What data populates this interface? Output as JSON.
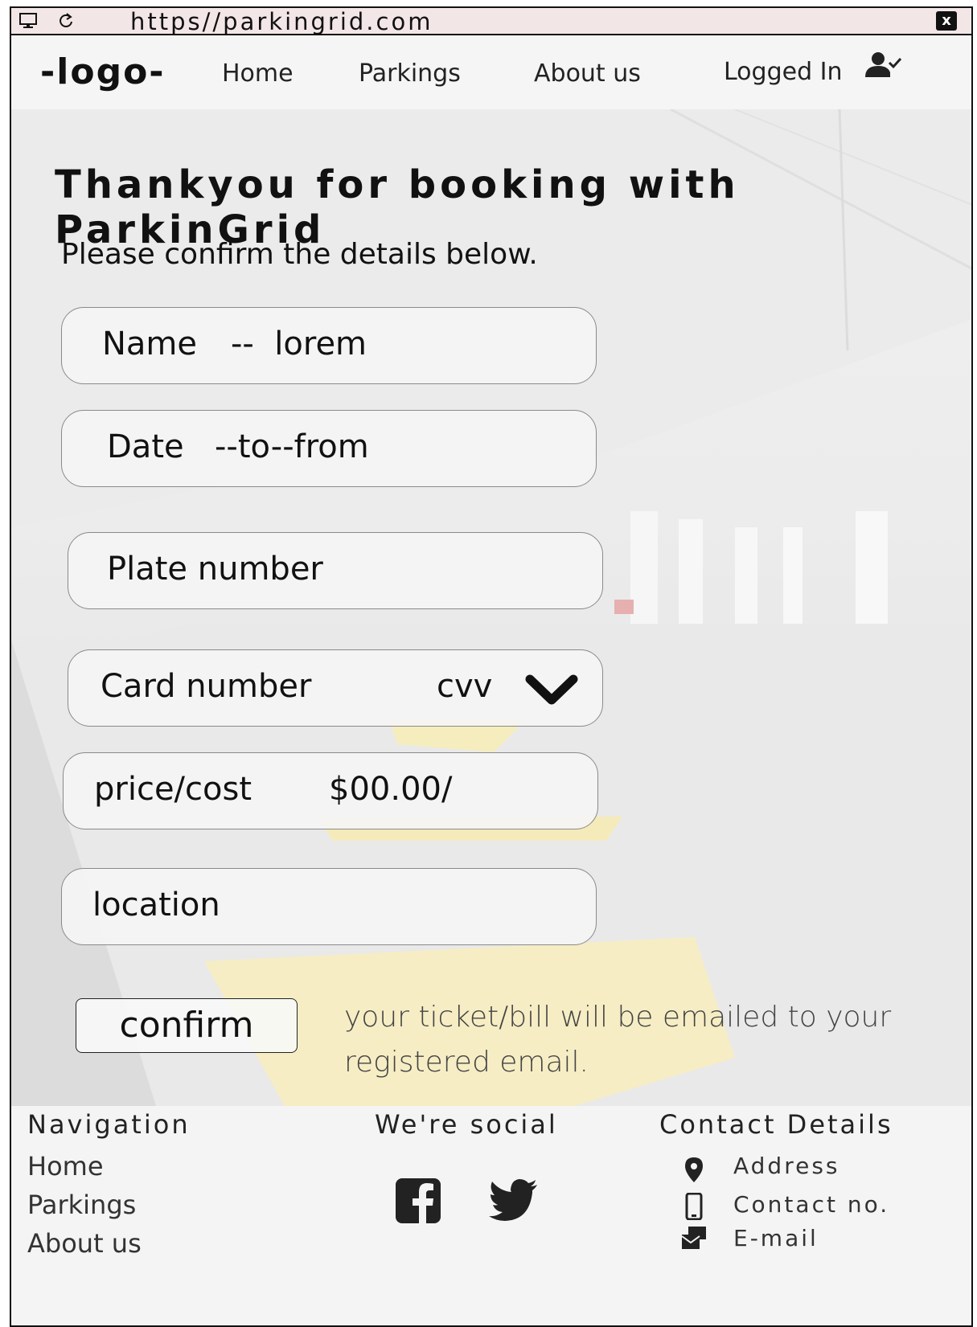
{
  "browser": {
    "url": "https//parkingrid.com",
    "close_label": "x"
  },
  "nav": {
    "logo": "-logo-",
    "home": "Home",
    "parkings": "Parkings",
    "about": "About us",
    "status": "Logged In"
  },
  "main": {
    "title": "Thankyou for booking with ParkinGrid",
    "subtitle": "Please confirm the details below.",
    "name_label": "Name",
    "name_value": "--  lorem",
    "date_label": "Date",
    "date_value": "--to--from",
    "plate_label": "Plate number",
    "card_label": "Card number",
    "cvv_label": "cvv",
    "price_label": "price/cost",
    "price_value": "$00.00/",
    "location_label": "location",
    "confirm_label": "confirm",
    "email_note": "your ticket/bill will be emailed to your registered email."
  },
  "footer": {
    "navigation_title": "Navigation",
    "nav_links": [
      "Home",
      "Parkings",
      "About us"
    ],
    "social_title": "We're social",
    "contact_title": "Contact Details",
    "contact_items": [
      "Address",
      "Contact no.",
      "E-mail"
    ]
  },
  "icons": {
    "monitor": "monitor-icon",
    "reload": "reload-icon",
    "close": "close-icon",
    "user": "user-check-icon",
    "chevron": "chevron-down-icon",
    "facebook": "facebook-icon",
    "twitter": "twitter-icon",
    "pin": "map-pin-icon",
    "phone": "phone-icon",
    "mail": "email-icon"
  },
  "colors": {
    "background": "#f4f4f4",
    "browser_bar": "#f3e6e6",
    "text": "#111111",
    "accent_yellow": "#f6e9a4"
  }
}
